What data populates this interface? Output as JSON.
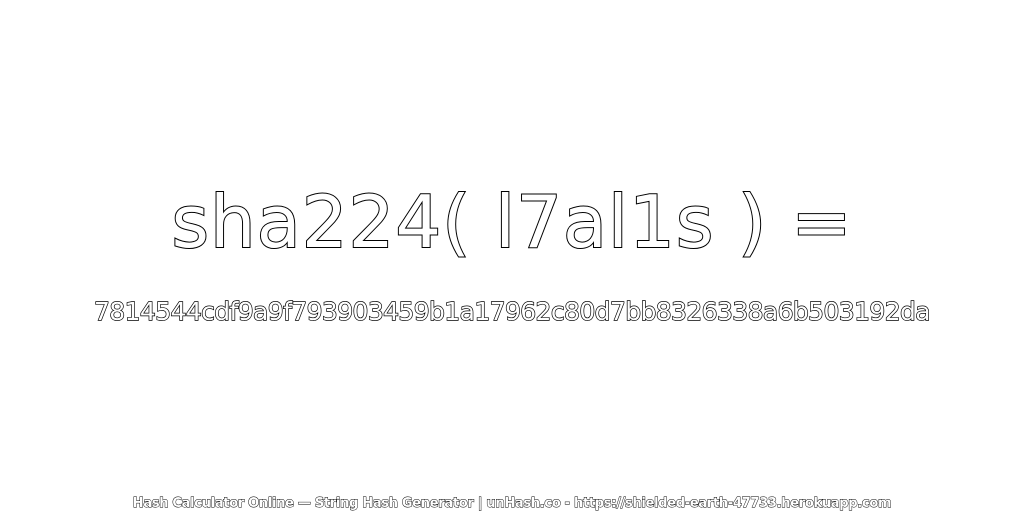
{
  "headline": "sha224( l7al1s ) =",
  "hash_value": "7814544cdf9a9f793903459b1a17962c80d7bb8326338a6b503192da",
  "footer": "Hash Calculator Online — String Hash Generator | unHash.co - https://shielded-earth-47733.herokuapp.com",
  "colors": {
    "background": "#ffffff",
    "text_fill": "#ffffff",
    "text_outline": "#000000"
  }
}
